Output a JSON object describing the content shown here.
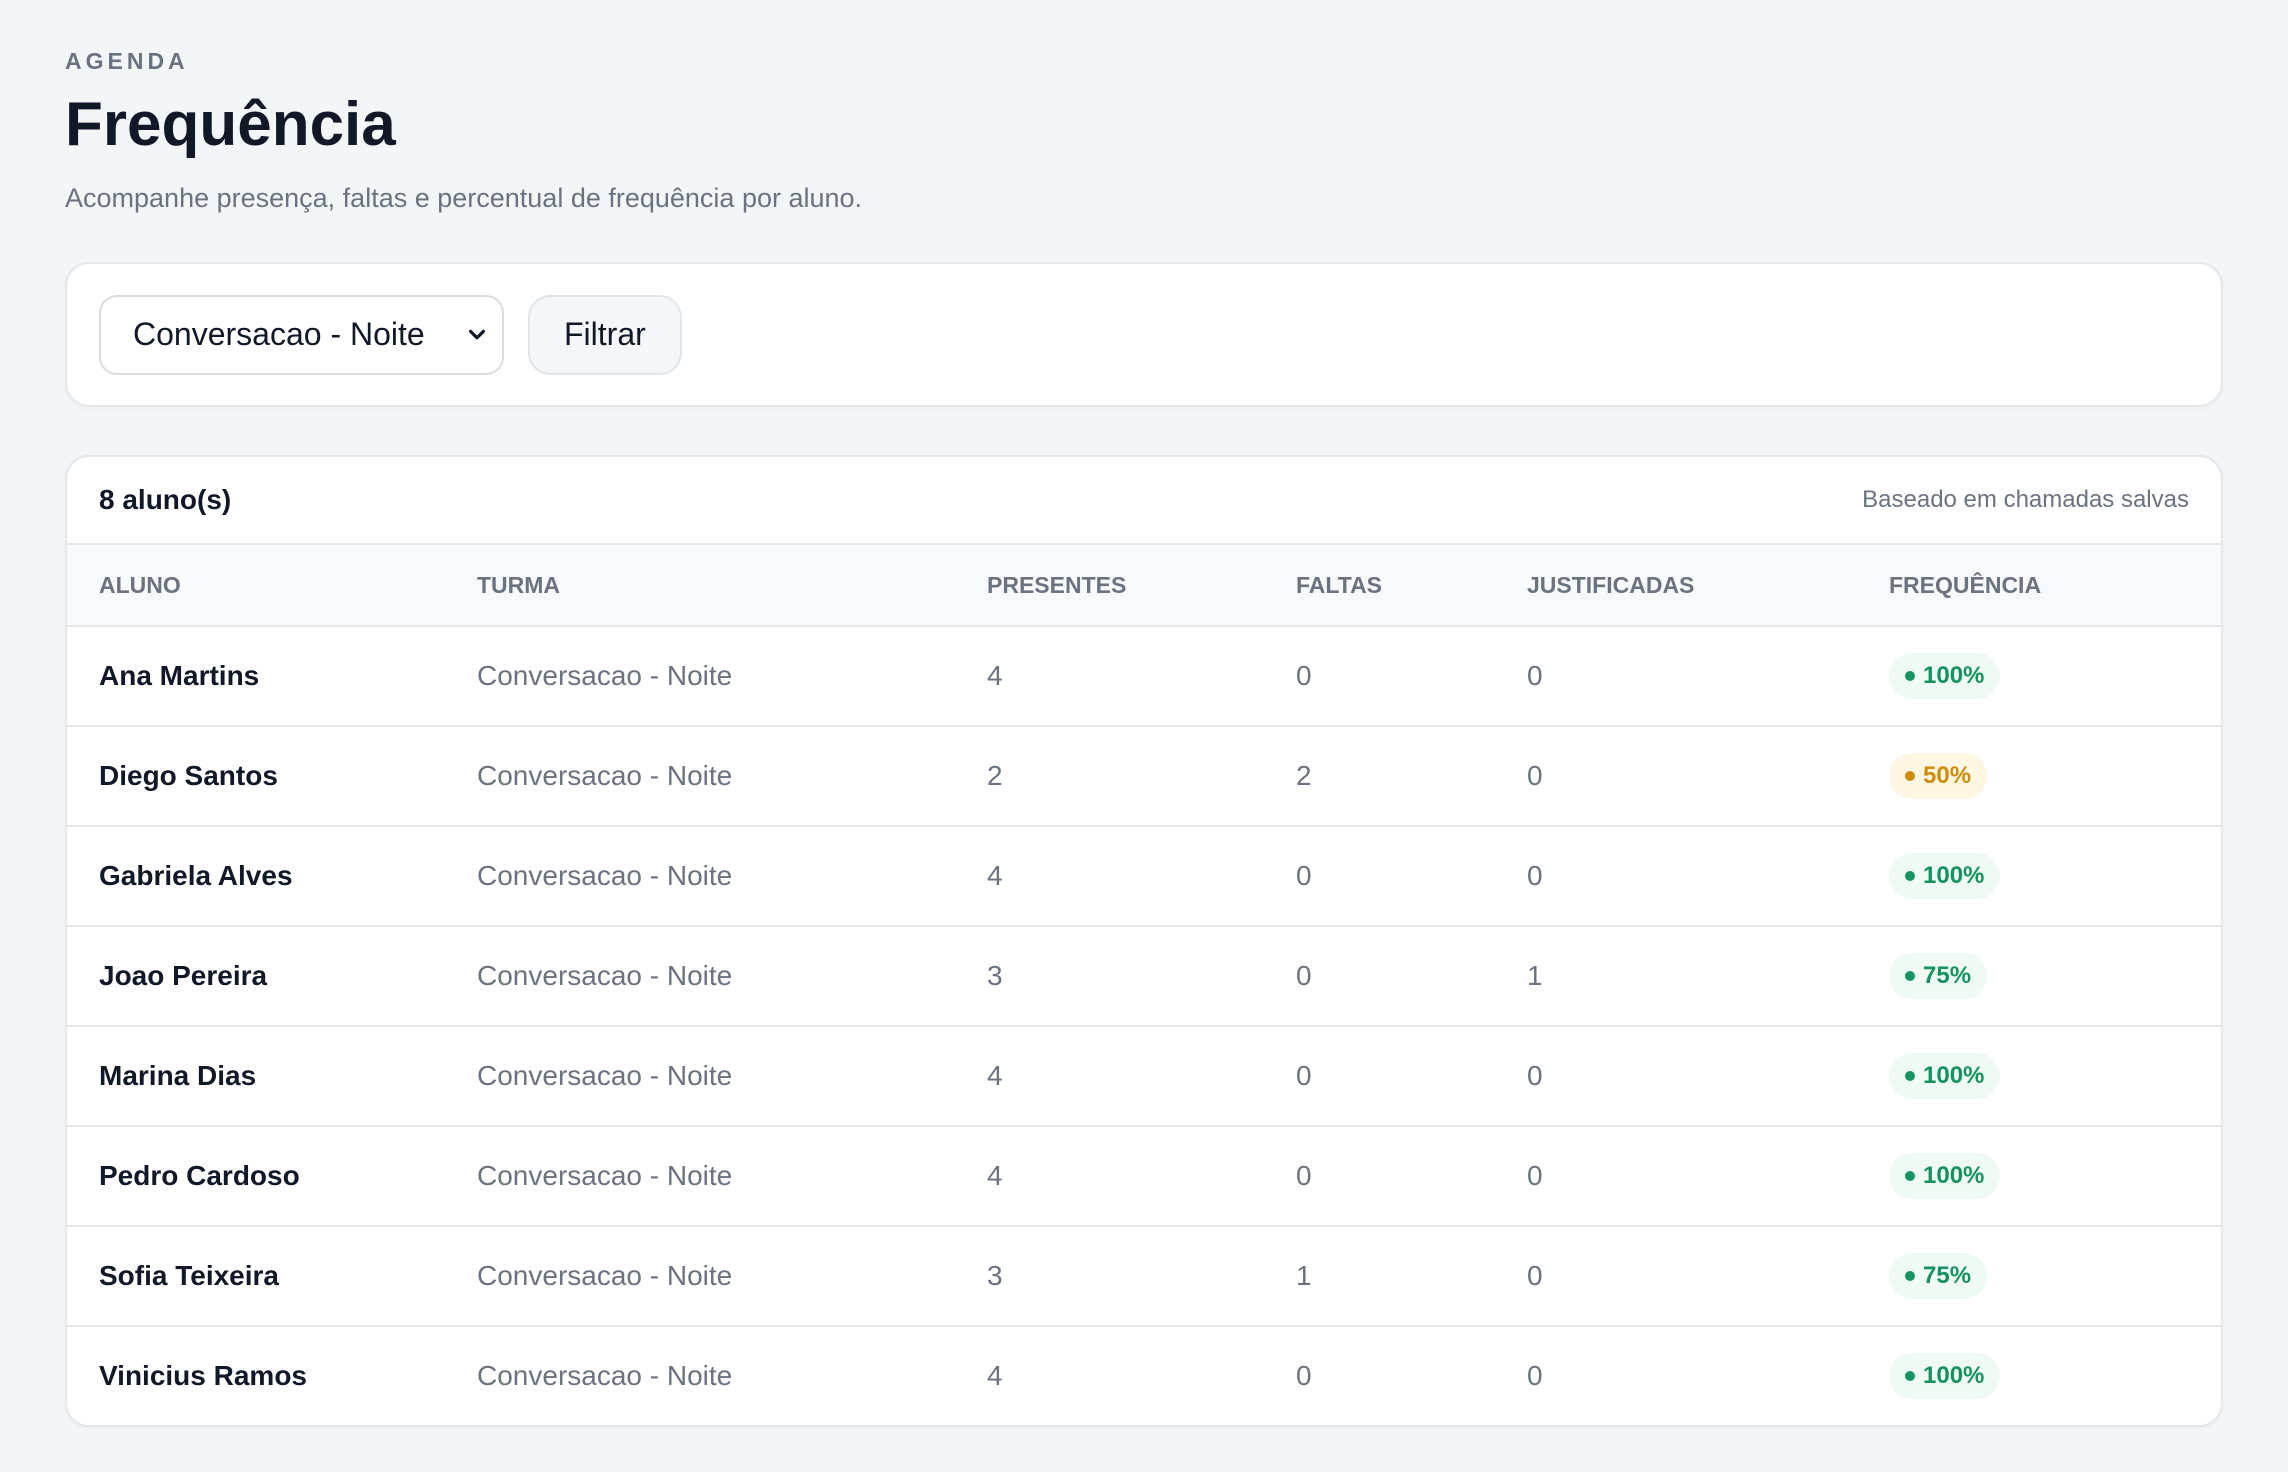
{
  "header": {
    "eyebrow": "AGENDA",
    "title": "Frequência",
    "subtitle": "Acompanhe presença, faltas e percentual de frequência por aluno."
  },
  "filter": {
    "select_value": "Conversacao - Noite",
    "button_label": "Filtrar"
  },
  "table": {
    "count_label": "8 aluno(s)",
    "note": "Baseado em chamadas salvas",
    "columns": [
      "ALUNO",
      "TURMA",
      "PRESENTES",
      "FALTAS",
      "JUSTIFICADAS",
      "FREQUÊNCIA"
    ],
    "rows": [
      {
        "aluno": "Ana Martins",
        "turma": "Conversacao - Noite",
        "presentes": "4",
        "faltas": "0",
        "justificadas": "0",
        "frequencia": "100%",
        "status": "good"
      },
      {
        "aluno": "Diego Santos",
        "turma": "Conversacao - Noite",
        "presentes": "2",
        "faltas": "2",
        "justificadas": "0",
        "frequencia": "50%",
        "status": "warn"
      },
      {
        "aluno": "Gabriela Alves",
        "turma": "Conversacao - Noite",
        "presentes": "4",
        "faltas": "0",
        "justificadas": "0",
        "frequencia": "100%",
        "status": "good"
      },
      {
        "aluno": "Joao Pereira",
        "turma": "Conversacao - Noite",
        "presentes": "3",
        "faltas": "0",
        "justificadas": "1",
        "frequencia": "75%",
        "status": "good"
      },
      {
        "aluno": "Marina Dias",
        "turma": "Conversacao - Noite",
        "presentes": "4",
        "faltas": "0",
        "justificadas": "0",
        "frequencia": "100%",
        "status": "good"
      },
      {
        "aluno": "Pedro Cardoso",
        "turma": "Conversacao - Noite",
        "presentes": "4",
        "faltas": "0",
        "justificadas": "0",
        "frequencia": "100%",
        "status": "good"
      },
      {
        "aluno": "Sofia Teixeira",
        "turma": "Conversacao - Noite",
        "presentes": "3",
        "faltas": "1",
        "justificadas": "0",
        "frequencia": "75%",
        "status": "good"
      },
      {
        "aluno": "Vinicius Ramos",
        "turma": "Conversacao - Noite",
        "presentes": "4",
        "faltas": "0",
        "justificadas": "0",
        "frequencia": "100%",
        "status": "good"
      }
    ]
  },
  "colors": {
    "background": "#f3f6f7",
    "good": "#15935e",
    "warn": "#d08c0b"
  },
  "icons": {
    "select_arrow": "chevron-down-icon",
    "badge_dot": "dot-icon"
  }
}
